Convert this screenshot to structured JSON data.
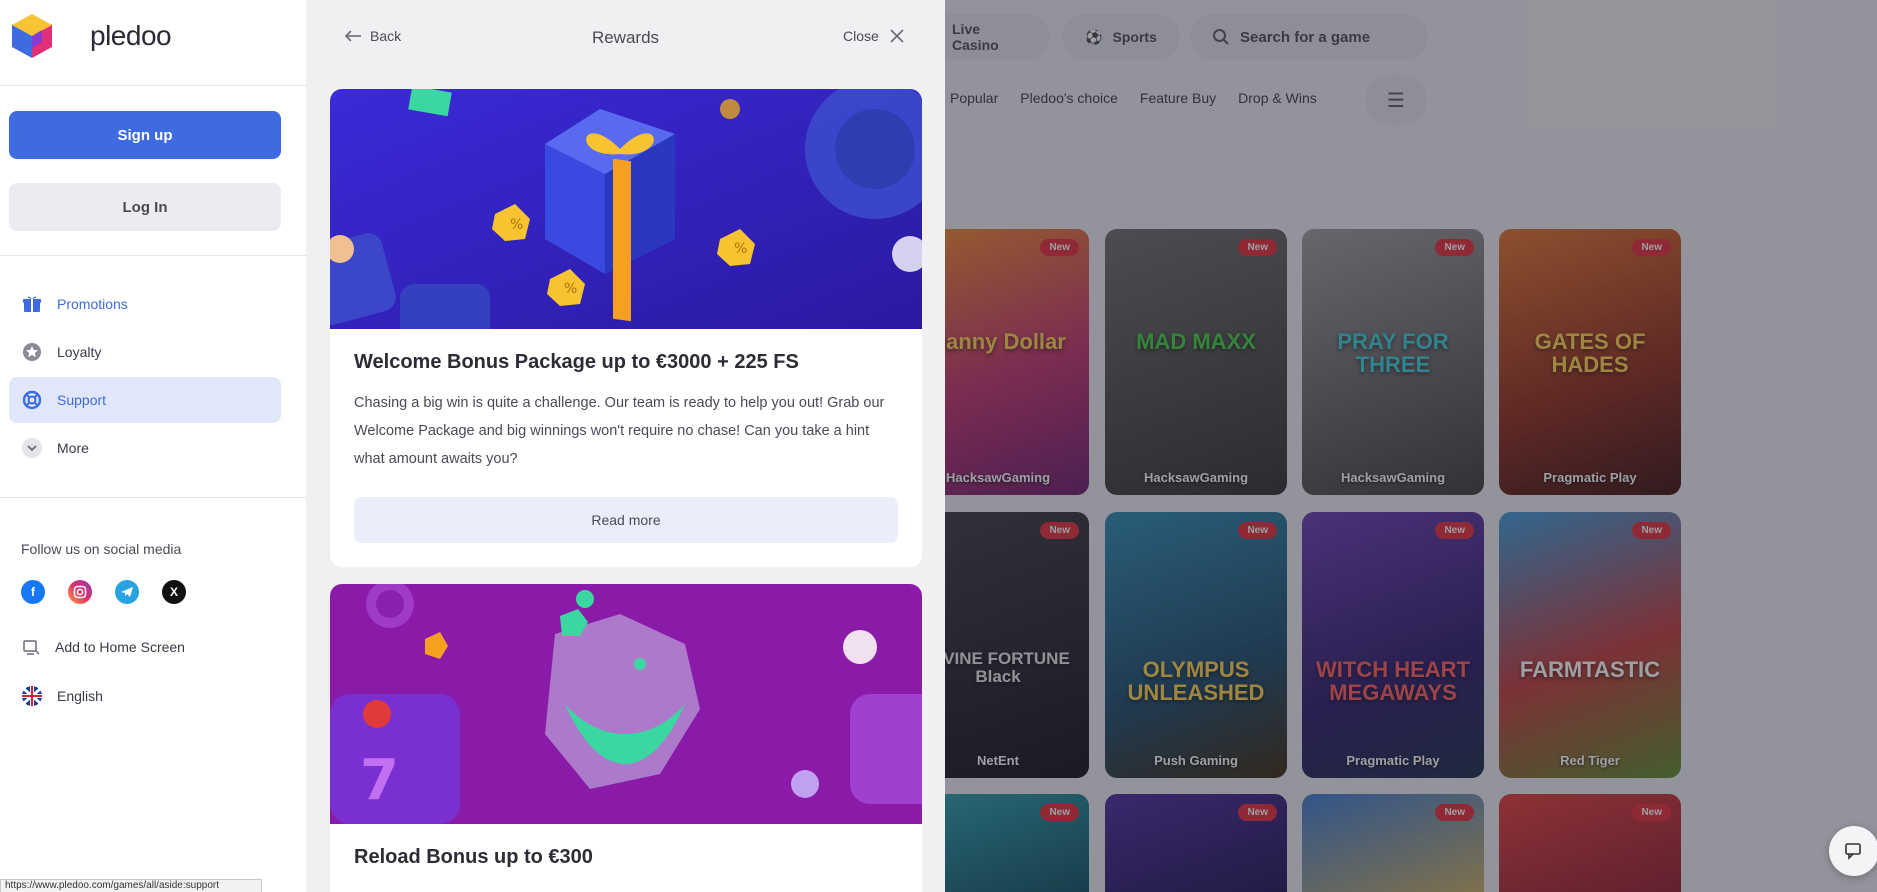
{
  "app": {
    "logo_text": "pledoo"
  },
  "auth": {
    "signup_label": "Sign up",
    "login_label": "Log In"
  },
  "sidebar": {
    "nav": [
      {
        "label": "Promotions",
        "icon": "gift-icon"
      },
      {
        "label": "Loyalty",
        "icon": "star-icon"
      },
      {
        "label": "Support",
        "icon": "lifebuoy-icon"
      },
      {
        "label": "More",
        "icon": "chevron-down-icon"
      }
    ],
    "follow_label": "Follow us on social media",
    "socials": [
      "facebook-icon",
      "instagram-icon",
      "telegram-icon",
      "x-icon"
    ],
    "add_home_label": "Add to Home Screen",
    "language_label": "English"
  },
  "status_bar": {
    "url": "https://www.pledoo.com/games/all/aside:support"
  },
  "panel": {
    "back_label": "Back",
    "title": "Rewards",
    "close_label": "Close",
    "cards": [
      {
        "title": "Welcome Bonus Package up to €3000 + 225 FS",
        "text": "Chasing a big win is quite a challenge. Our team is ready to help you out! Grab our Welcome Package and big winnings won't require no chase! Can you take a hint what amount awaits you?",
        "button_label": "Read more"
      },
      {
        "title": "Reload Bonus up to €300"
      }
    ]
  },
  "background": {
    "top_nav": {
      "live_casino": "Live Casino",
      "sports": "Sports",
      "search_placeholder": "Search for a game"
    },
    "categories": [
      "Popular",
      "Pledoo's choice",
      "Feature Buy",
      "Drop & Wins"
    ],
    "new_badge": "New",
    "games": [
      {
        "name": "Danny Dollar",
        "provider": "HacksawGaming"
      },
      {
        "name": "MAD MAXX",
        "provider": "HacksawGaming"
      },
      {
        "name": "PRAY FOR THREE",
        "provider": "HacksawGaming"
      },
      {
        "name": "GATES OF HADES",
        "provider": "Pragmatic Play"
      },
      {
        "name": "DIVINE FORTUNE Black",
        "provider": "NetEnt"
      },
      {
        "name": "OLYMPUS UNLEASHED",
        "provider": "Push Gaming"
      },
      {
        "name": "WITCH HEART MEGAWAYS",
        "provider": "Pragmatic Play"
      },
      {
        "name": "FARMTASTIC",
        "provider": "Red Tiger"
      },
      {
        "name": "",
        "provider": ""
      },
      {
        "name": "",
        "provider": ""
      },
      {
        "name": "",
        "provider": ""
      },
      {
        "name": "",
        "provider": ""
      }
    ]
  },
  "colors": {
    "accent": "#3f6be0",
    "badge": "#e52a3a"
  }
}
